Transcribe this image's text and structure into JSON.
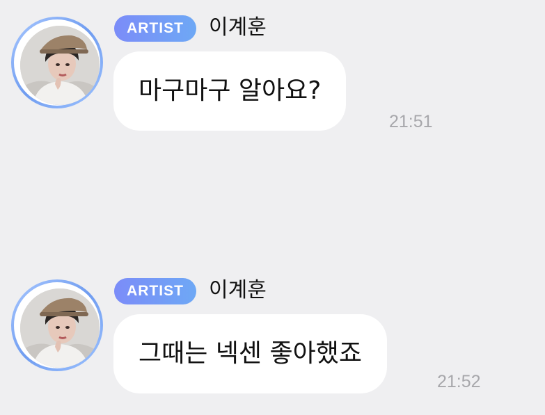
{
  "messages": [
    {
      "badge": "ARTIST",
      "sender": "이계훈",
      "text": "마구마구 알아요?",
      "time": "21:51",
      "avatar_icon": "artist-profile-photo"
    },
    {
      "badge": "ARTIST",
      "sender": "이계훈",
      "text": "그때는 넥센 좋아했죠",
      "time": "21:52",
      "avatar_icon": "artist-profile-photo"
    }
  ],
  "colors": {
    "background": "#efeff1",
    "bubble": "#ffffff",
    "badge_start": "#7b8cf8",
    "badge_end": "#6ea8f5",
    "avatar_ring": "#6f9cf0",
    "timestamp": "#a7a7ab"
  }
}
